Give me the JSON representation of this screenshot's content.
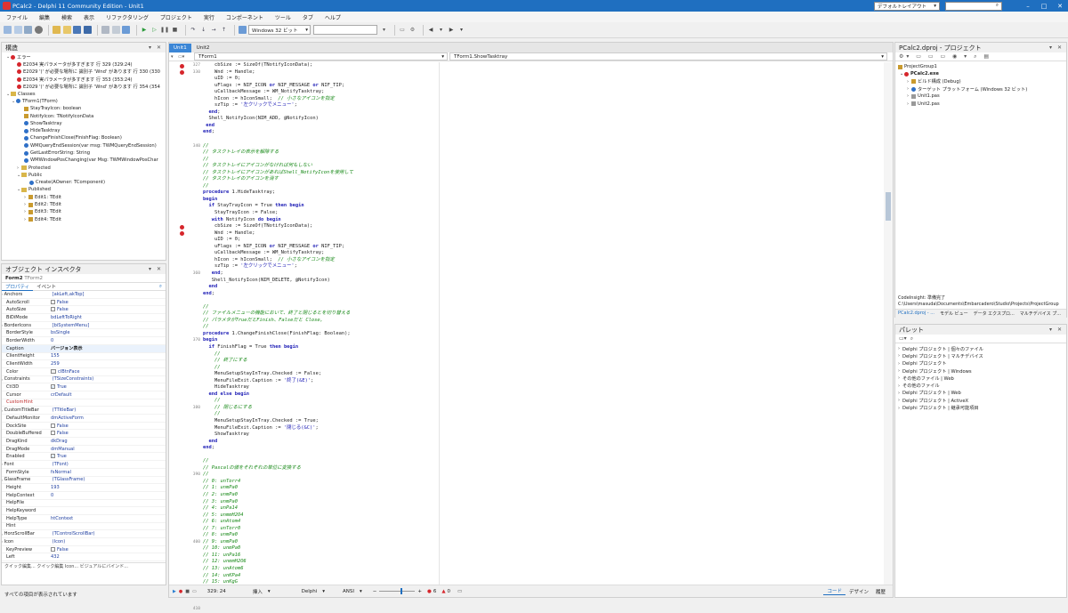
{
  "window": {
    "title": "PCalc2 - Delphi 11 Community Edition - Unit1",
    "layout": "デフォルトレイアウト",
    "search_placeholder": "",
    "minimize": "–",
    "maximize": "□",
    "close": "✕"
  },
  "menu": [
    "ファイル",
    "編集",
    "検索",
    "表示",
    "リファクタリング",
    "プロジェクト",
    "実行",
    "コンポーネント",
    "ツール",
    "タブ",
    "ヘルプ"
  ],
  "toolbar": {
    "platform": "Windows 32 ビット",
    "config": ""
  },
  "structure": {
    "title": "構造",
    "errors_label": "エラー",
    "errors": [
      "E2034 実パラメータが多すぎます 行 329 (329:24)",
      "E2029 ')' が必要な場所に 識別子 'Wnd' があります 行 330 (330:...",
      "E2034 実パラメータが多すぎます 行 353 (353:24)",
      "E2029 ')' が必要な場所に 識別子 'Wnd' があります 行 354 (354:..."
    ],
    "errors_short": [
      "E2034 実パラメータが多すぎます 行 329 (329:24)",
      "E2029 ')' が必要な場所に 識別子 'Wnd' があります 行 330 (330",
      "E2034 実パラメータが多すぎます 行 353 (353:24)",
      "E2029 ')' が必要な場所に 識別子 'Wnd' があります 行 354 (354"
    ],
    "classes_label": "Classes",
    "form_class": "TForm1(TForm)",
    "members": [
      "StayTrayIcon: boolean",
      "NotifyIcon: TNotifyIconData",
      "ShowTasktray",
      "HideTasktray",
      "ChangeFinishClose(FinishFlag: Boolean)",
      "WMQueryEndSession(var msg: TWMQueryEndSession)",
      "GetLastErrorString: String",
      "WMWindowPosChanging(var Msg: TWMWindowPosChar"
    ],
    "protected": "Protected",
    "public": "Public",
    "create": "Create(AOwner: TComponent)",
    "published": "Published",
    "published_items": [
      "Edit1: TEdit",
      "Edit2: TEdit",
      "Edit3: TEdit",
      "Edit4: TEdit"
    ]
  },
  "inspector": {
    "title": "オブジェクト インスペクタ",
    "object": "Form2",
    "object_type": "TForm2",
    "tab_props": "プロパティ",
    "tab_events": "イベント",
    "props": [
      [
        "Anchors",
        "[akLeft,akTop]"
      ],
      [
        "AutoScroll",
        "False"
      ],
      [
        "AutoSize",
        "False"
      ],
      [
        "BiDiMode",
        "bdLeftToRight"
      ],
      [
        "BorderIcons",
        "[biSystemMenu]"
      ],
      [
        "BorderStyle",
        "bsSingle"
      ],
      [
        "BorderWidth",
        "0"
      ],
      [
        "Caption",
        "バージョン表示"
      ],
      [
        "ClientHeight",
        "155"
      ],
      [
        "ClientWidth",
        "259"
      ],
      [
        "Color",
        "clBtnFace"
      ],
      [
        "Constraints",
        "(TSizeConstraints)"
      ],
      [
        "Ctl3D",
        "True"
      ],
      [
        "Cursor",
        "crDefault"
      ],
      [
        "CustomHint",
        ""
      ],
      [
        "CustomTitleBar",
        "(TTitleBar)"
      ],
      [
        "DefaultMonitor",
        "dmActiveForm"
      ],
      [
        "DockSite",
        "False"
      ],
      [
        "DoubleBuffered",
        "False"
      ],
      [
        "DragKind",
        "dkDrag"
      ],
      [
        "DragMode",
        "dmManual"
      ],
      [
        "Enabled",
        "True"
      ],
      [
        "Font",
        "(TFont)"
      ],
      [
        "FormStyle",
        "fsNormal"
      ],
      [
        "GlassFrame",
        "(TGlassFrame)"
      ],
      [
        "Height",
        "193"
      ],
      [
        "HelpContext",
        "0"
      ],
      [
        "HelpFile",
        ""
      ],
      [
        "HelpKeyword",
        ""
      ],
      [
        "HelpType",
        "htContext"
      ],
      [
        "Hint",
        ""
      ],
      [
        "HorzScrollBar",
        "(TControlScrollBar)"
      ],
      [
        "Icon",
        "(Icon)"
      ],
      [
        "KeyPreview",
        "False"
      ],
      [
        "Left",
        "432"
      ]
    ],
    "footer": "クイック編集...  クイック編集 Icon...  ビジュアルにバインド...",
    "status": "すべての項目が表示されています"
  },
  "editor": {
    "tabs": [
      "Unit1",
      "Unit2"
    ],
    "nav_left": "TForm1",
    "nav_right": "TForm1.ShowTasktray",
    "status_pos": "329: 24",
    "status_mode": "挿入",
    "status_lang": "Delphi",
    "status_enc": "ANSI",
    "zoom_num1": "6",
    "zoom_num2": "0",
    "tab_code": "コード",
    "tab_design": "デザイン",
    "tab_history": "履歴"
  },
  "code_lines": [
    {
      "n": "327",
      "t": "    cbSize := SizeOf(TNotifyIconData);",
      "dot": true
    },
    {
      "n": "330",
      "t": "    Wnd := Handle;",
      "dot": true
    },
    {
      "n": "",
      "t": "    uID := 0;"
    },
    {
      "n": "",
      "t": "    uFlags := NIF_ICON or NIF_MESSAGE or NIF_TIP;"
    },
    {
      "n": "",
      "t": "    uCallbackMessage := WM_NotifyTasktray;"
    },
    {
      "n": "",
      "t": "    hIcon := hIconSmall;  // 小さなアイコンを指定"
    },
    {
      "n": "",
      "t": "    szTip := '左クリックでメニュー';"
    },
    {
      "n": "",
      "t": "  end;"
    },
    {
      "n": "",
      "t": "  Shell_NotifyIcon(NIM_ADD, @NotifyIcon)"
    },
    {
      "n": "",
      "t": " end"
    },
    {
      "n": "",
      "t": "end;"
    },
    {
      "n": "",
      "t": ""
    },
    {
      "n": "340",
      "t": "//"
    },
    {
      "n": "",
      "t": "// タスクトレイの表示を解除する"
    },
    {
      "n": "",
      "t": "//"
    },
    {
      "n": "",
      "t": "// タスクトレイにアイコンがなければ何もしない"
    },
    {
      "n": "",
      "t": "// タスクトレイにアイコンがあればShell_NotifyIconを使用して"
    },
    {
      "n": "",
      "t": "// タスクトレイのアイコンを消す"
    },
    {
      "n": "",
      "t": "//"
    },
    {
      "n": "",
      "t": "procedure TForm1.HideTasktray;"
    },
    {
      "n": "",
      "t": "begin"
    },
    {
      "n": "",
      "t": "  if StayTrayIcon = True then begin"
    },
    {
      "n": "",
      "t": "    StayTrayIcon := False;"
    },
    {
      "n": "",
      "t": "   with NotifyIcon do begin"
    },
    {
      "n": "",
      "t": "    cbSize := SizeOf(TNotifyIconData);",
      "dot": true
    },
    {
      "n": "",
      "t": "    Wnd := Handle;",
      "dot": true
    },
    {
      "n": "",
      "t": "    uID := 0;"
    },
    {
      "n": "",
      "t": "    uFlags := NIF_ICON or NIF_MESSAGE or NIF_TIP;"
    },
    {
      "n": "",
      "t": "    uCallbackMessage := WM_NotifyTasktray;"
    },
    {
      "n": "",
      "t": "    hIcon := hIconSmall;  // 小さなアイコンを指定"
    },
    {
      "n": "",
      "t": "    szTip := '左クリックでメニュー';"
    },
    {
      "n": "360",
      "t": "   end;"
    },
    {
      "n": "",
      "t": "   Shell_NotifyIcon(NIM_DELETE, @NotifyIcon)"
    },
    {
      "n": "",
      "t": "  end"
    },
    {
      "n": "",
      "t": "end;"
    },
    {
      "n": "",
      "t": ""
    },
    {
      "n": "",
      "t": "//"
    },
    {
      "n": "",
      "t": "// ファイルメニューの機能において、終了と閉じるとを切り替える"
    },
    {
      "n": "",
      "t": "// パラメタがTrueだとFinish、Falseだと Close,"
    },
    {
      "n": "",
      "t": "//"
    },
    {
      "n": "",
      "t": "procedure TForm1.ChangeFinishClose(FinishFlag: Boolean);"
    },
    {
      "n": "370",
      "t": "begin"
    },
    {
      "n": "",
      "t": "  if FinishFlag = True then begin"
    },
    {
      "n": "",
      "t": "    //"
    },
    {
      "n": "",
      "t": "    // 終了にする"
    },
    {
      "n": "",
      "t": "    //"
    },
    {
      "n": "",
      "t": "    MenuSetupStayInTray.Checked := False;"
    },
    {
      "n": "",
      "t": "    MenuFileExit.Caption := '終了(&E)';"
    },
    {
      "n": "",
      "t": "    HideTasktray"
    },
    {
      "n": "",
      "t": "  end else begin"
    },
    {
      "n": "",
      "t": "    //"
    },
    {
      "n": "380",
      "t": "    // 閉じるにする"
    },
    {
      "n": "",
      "t": "    //"
    },
    {
      "n": "",
      "t": "    MenuSetupStayInTray.Checked := True;"
    },
    {
      "n": "",
      "t": "    MenuFileExit.Caption := '閉じる(&C)';"
    },
    {
      "n": "",
      "t": "    ShowTasktray"
    },
    {
      "n": "",
      "t": "  end"
    },
    {
      "n": "",
      "t": "end;"
    },
    {
      "n": "",
      "t": ""
    },
    {
      "n": "",
      "t": "//"
    },
    {
      "n": "",
      "t": "// Pascalの値をそれぞれの単位に変換する"
    },
    {
      "n": "390",
      "t": "//"
    },
    {
      "n": "",
      "t": "// 0: unTorr4"
    },
    {
      "n": "",
      "t": "// 1: unmPa0"
    },
    {
      "n": "",
      "t": "// 2: unmPa0"
    },
    {
      "n": "",
      "t": "// 3: unmPa0"
    },
    {
      "n": "",
      "t": "// 4: unPa14"
    },
    {
      "n": "",
      "t": "// 5: unmmH2O4"
    },
    {
      "n": "",
      "t": "// 6: unAtom4"
    },
    {
      "n": "",
      "t": "// 7: unTorr0"
    },
    {
      "n": "",
      "t": "// 8: unmPa0"
    },
    {
      "n": "400",
      "t": "// 9: unmPa0"
    },
    {
      "n": "",
      "t": "// 10: unmPa0"
    },
    {
      "n": "",
      "t": "// 11: unPa16"
    },
    {
      "n": "",
      "t": "// 12: unmmH2O6"
    },
    {
      "n": "",
      "t": "// 13: unAtom6"
    },
    {
      "n": "",
      "t": "// 14: unKPa4"
    },
    {
      "n": "",
      "t": "// 15: unKgG"
    },
    {
      "n": "",
      "t": "// 16: unKg-cm-24"
    },
    {
      "n": "",
      "t": "// 17: unKg-cm-26"
    },
    {
      "n": "",
      "t": ""
    },
    {
      "n": "410",
      "t": "procedure PascalToOtherUnit(PaPress: Extended;"
    }
  ],
  "project": {
    "title": "PCalc2.dproj - プロジェクト",
    "group": "ProjectGroup1",
    "exe": "PCalc2.exe",
    "items": [
      "ビルド構成 (Debug)",
      "ターゲット プラットフォーム (Windows 32 ビット)",
      "Unit1.pas",
      "Unit2.pas"
    ],
    "codeinsight": "CodeInsight: 準備完了",
    "path": "C:\\Users\\masuda\\Documents\\Embarcadero\\Studio\\Projects\\ProjectGroup",
    "tabs": [
      "PCalc2.dproj - ...",
      "モデル ビュー",
      "データ エクスプロ...",
      "マルチデバイス プ..."
    ]
  },
  "palette": {
    "title": "パレット",
    "items": [
      "Delphi プロジェクト | 個々のファイル",
      "Delphi プロジェクト | マルチデバイス",
      "Delphi プロジェクト",
      "Delphi プロジェクト | Windows",
      "その他のファイル | Web",
      "その他のファイル",
      "Delphi プロジェクト | Web",
      "Delphi プロジェクト | ActiveX",
      "Delphi プロジェクト | 継承可能項目"
    ]
  }
}
